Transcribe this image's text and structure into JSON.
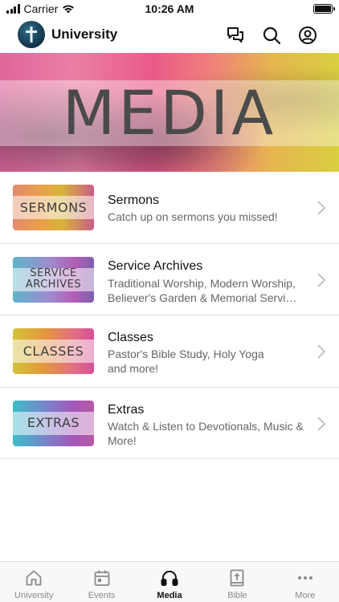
{
  "status_bar": {
    "carrier": "Carrier",
    "time": "10:26 AM"
  },
  "header": {
    "title": "University"
  },
  "banner": {
    "title": "MEDIA"
  },
  "items": [
    {
      "thumb_text": "SERMONS",
      "title": "Sermons",
      "subtitle": "Catch up on sermons you missed!"
    },
    {
      "thumb_text": "SERVICE ARCHIVES",
      "title": "Service Archives",
      "subtitle": "Traditional Worship, Modern Worship, Believer's Garden & Memorial Servi…"
    },
    {
      "thumb_text": "CLASSES",
      "title": "Classes",
      "subtitle": "Pastor's Bible Study, Holy Yoga and more!"
    },
    {
      "thumb_text": "EXTRAS",
      "title": "Extras",
      "subtitle": "Watch & Listen to Devotionals, Music & More!"
    }
  ],
  "tabs": [
    {
      "label": "University",
      "icon": "home-icon"
    },
    {
      "label": "Events",
      "icon": "calendar-icon"
    },
    {
      "label": "Media",
      "icon": "headphones-icon",
      "active": true
    },
    {
      "label": "Bible",
      "icon": "bible-icon"
    },
    {
      "label": "More",
      "icon": "more-icon"
    }
  ]
}
